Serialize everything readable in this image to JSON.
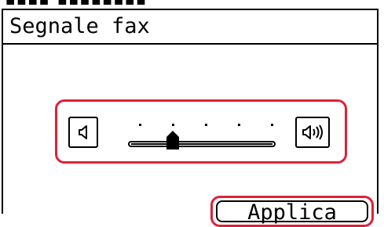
{
  "screen": {
    "title": "Segnale fax"
  },
  "volume": {
    "level": 2,
    "max": 5,
    "decrease_icon": "speaker-low-icon",
    "increase_icon": "speaker-high-icon"
  },
  "actions": {
    "apply_label": "Applica"
  },
  "colors": {
    "selection_border": "#e0203a",
    "foreground": "#000000",
    "background": "#ffffff"
  }
}
